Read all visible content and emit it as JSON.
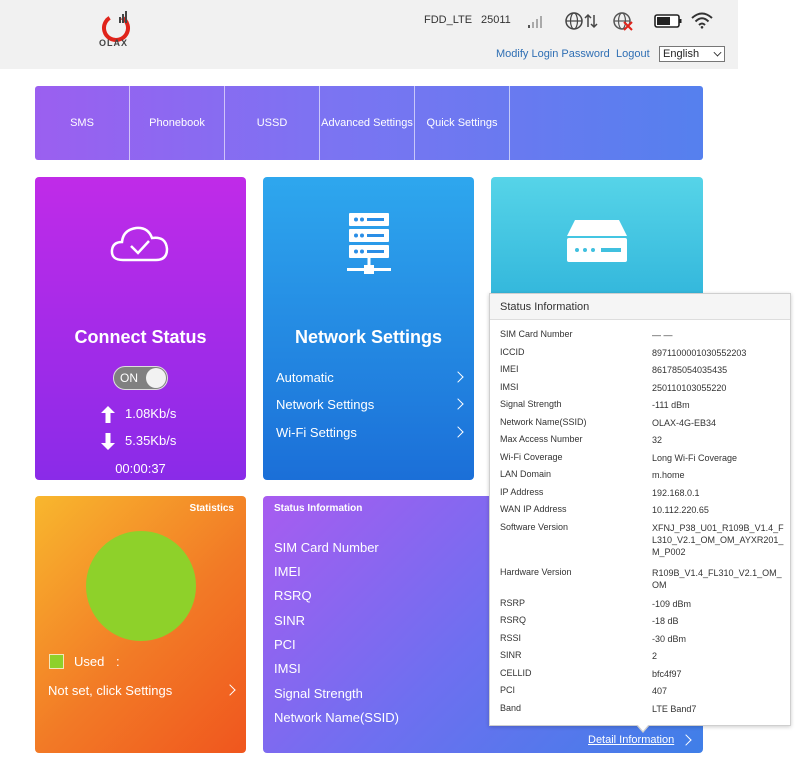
{
  "header": {
    "logo_text": "OLAX",
    "network_type": "FDD_LTE",
    "network_code": "25011",
    "modify_password": "Modify Login Password",
    "logout": "Logout",
    "language": "English"
  },
  "nav": {
    "items": [
      {
        "label": "SMS"
      },
      {
        "label": "Phonebook"
      },
      {
        "label": "USSD"
      },
      {
        "label": "Advanced Settings"
      },
      {
        "label": "Quick Settings"
      }
    ]
  },
  "connect": {
    "title": "Connect Status",
    "toggle_label": "ON",
    "upload_rate": "1.08Kb/s",
    "download_rate": "5.35Kb/s",
    "duration": "00:00:37"
  },
  "network": {
    "title": "Network Settings",
    "links": [
      {
        "label": "Automatic"
      },
      {
        "label": "Network Settings"
      },
      {
        "label": "Wi-Fi Settings"
      }
    ]
  },
  "statistics": {
    "title": "Statistics",
    "used_label": "Used",
    "used_sep": ":",
    "not_set": "Not set, click Settings"
  },
  "status_card": {
    "title": "Status Information",
    "labels": [
      "SIM Card Number",
      "IMEI",
      "RSRQ",
      "SINR",
      "PCI",
      "IMSI",
      "Signal Strength",
      "Network Name(SSID)"
    ],
    "detail_link": "Detail Information"
  },
  "popup": {
    "title": "Status Information",
    "rows": [
      {
        "label": "SIM Card Number",
        "value": "— —"
      },
      {
        "label": "ICCID",
        "value": "8971100001030552203"
      },
      {
        "label": "IMEI",
        "value": "861785054035435"
      },
      {
        "label": "IMSI",
        "value": "250110103055220"
      },
      {
        "label": "Signal Strength",
        "value": "-111 dBm"
      },
      {
        "label": "Network Name(SSID)",
        "value": "OLAX-4G-EB34"
      },
      {
        "label": "Max Access Number",
        "value": "32"
      },
      {
        "label": "Wi-Fi Coverage",
        "value": "Long Wi-Fi Coverage"
      },
      {
        "label": "LAN Domain",
        "value": "m.home"
      },
      {
        "label": "IP Address",
        "value": "192.168.0.1"
      },
      {
        "label": "WAN IP Address",
        "value": "10.112.220.65"
      },
      {
        "label": "Software Version",
        "value": "XFNJ_P38_U01_R109B_V1.4_FL310_V2.1_OM_OM_AYXR201_M_P002"
      },
      {
        "label": "Hardware Version",
        "value": "R109B_V1.4_FL310_V2.1_OM_OM"
      },
      {
        "label": "RSRP",
        "value": "-109 dBm"
      },
      {
        "label": "RSRQ",
        "value": "-18 dB"
      },
      {
        "label": "RSSI",
        "value": "-30 dBm"
      },
      {
        "label": "SINR",
        "value": "2"
      },
      {
        "label": "CELLID",
        "value": "bfc4f97"
      },
      {
        "label": "PCI",
        "value": "407"
      },
      {
        "label": "Band",
        "value": "LTE Band7"
      }
    ]
  },
  "colors": {
    "accent_link": "#2f6fb4",
    "used_indicator": "#8ed12a"
  },
  "icons": {
    "logo": "olax-logo-icon",
    "signal": "signal-bars-icon",
    "globe": "globe-data-icon",
    "no_connection": "globe-disabled-icon",
    "battery": "battery-icon",
    "wifi": "wifi-icon",
    "cloud": "cloud-check-icon",
    "server": "server-network-icon",
    "router": "router-device-icon"
  }
}
